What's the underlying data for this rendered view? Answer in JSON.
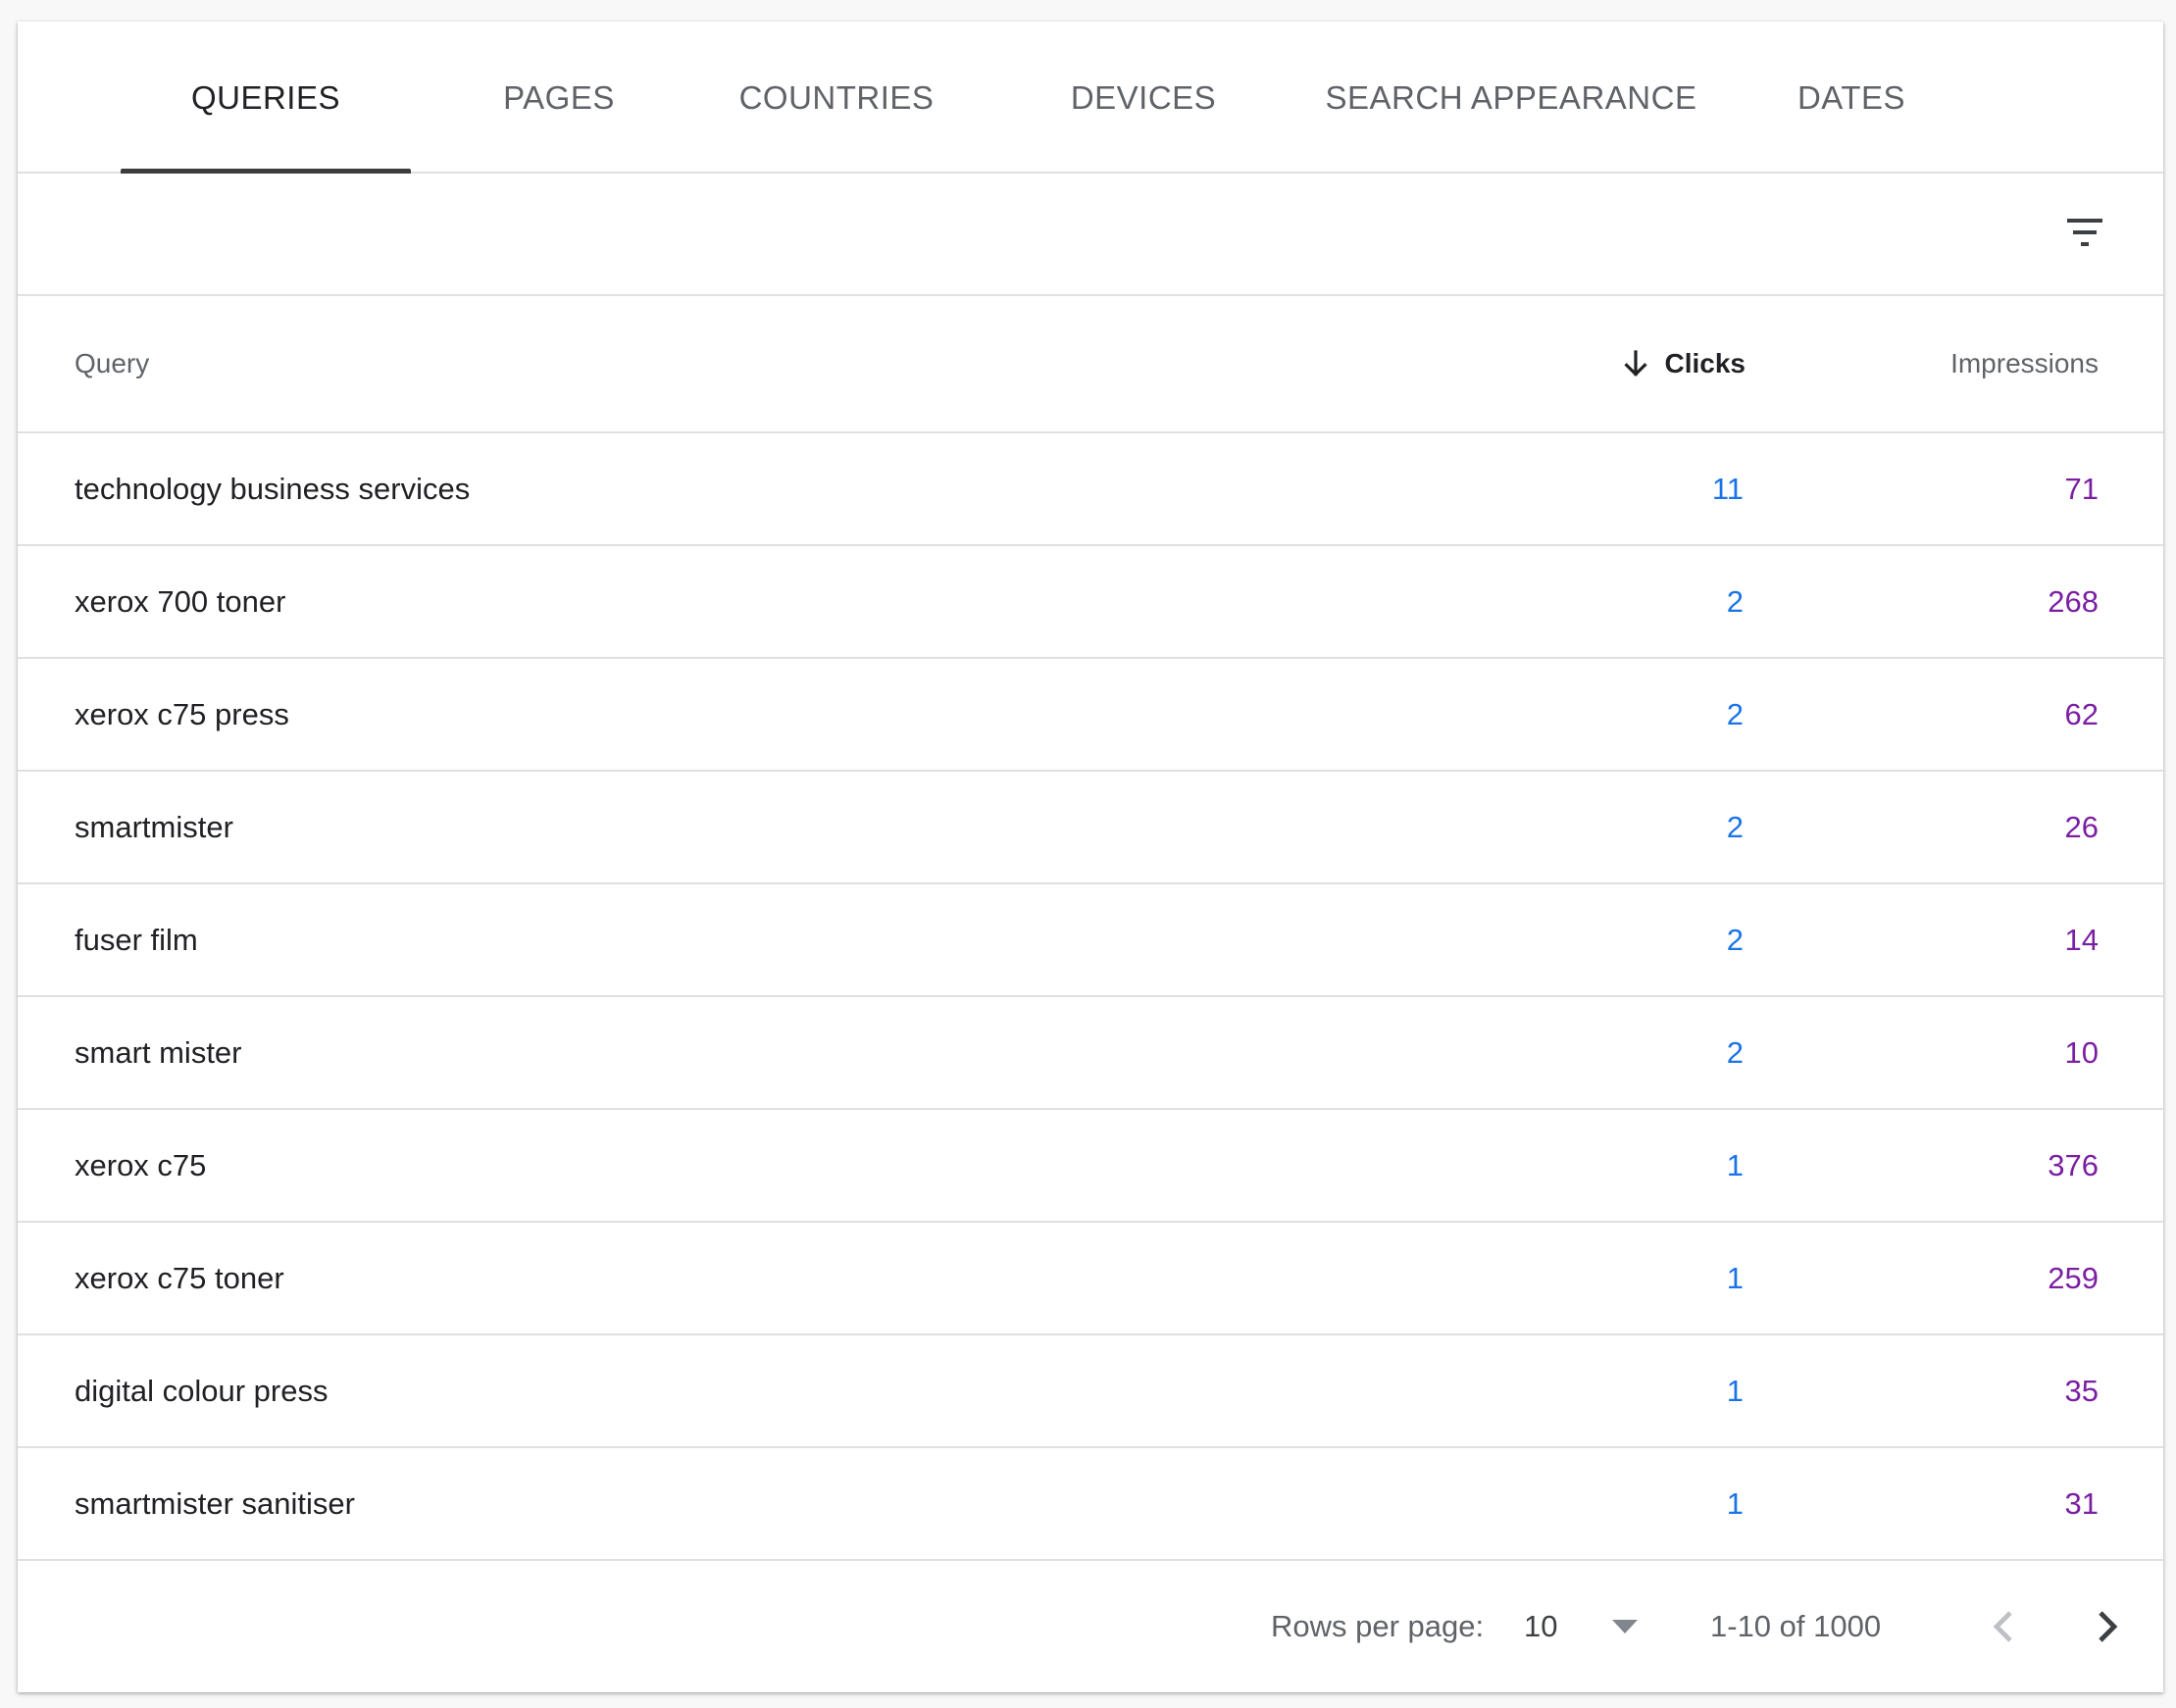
{
  "tabs": [
    {
      "label": "QUERIES",
      "active": true
    },
    {
      "label": "PAGES",
      "active": false
    },
    {
      "label": "COUNTRIES",
      "active": false
    },
    {
      "label": "DEVICES",
      "active": false
    },
    {
      "label": "SEARCH APPEARANCE",
      "active": false
    },
    {
      "label": "DATES",
      "active": false
    }
  ],
  "filter": {
    "icon": "filter-icon"
  },
  "table": {
    "headers": {
      "query": "Query",
      "clicks": "Clicks",
      "impressions": "Impressions",
      "sort_icon": "arrow-down-icon"
    },
    "rows": [
      {
        "query": "technology business services",
        "clicks": "11",
        "impressions": "71"
      },
      {
        "query": "xerox 700 toner",
        "clicks": "2",
        "impressions": "268"
      },
      {
        "query": "xerox c75 press",
        "clicks": "2",
        "impressions": "62"
      },
      {
        "query": "smartmister",
        "clicks": "2",
        "impressions": "26"
      },
      {
        "query": "fuser film",
        "clicks": "2",
        "impressions": "14"
      },
      {
        "query": "smart mister",
        "clicks": "2",
        "impressions": "10"
      },
      {
        "query": "xerox c75",
        "clicks": "1",
        "impressions": "376"
      },
      {
        "query": "xerox c75 toner",
        "clicks": "1",
        "impressions": "259"
      },
      {
        "query": "digital colour press",
        "clicks": "1",
        "impressions": "35"
      },
      {
        "query": "smartmister sanitiser",
        "clicks": "1",
        "impressions": "31"
      }
    ]
  },
  "pagination": {
    "rows_per_page_label": "Rows per page:",
    "rows_per_page_value": "10",
    "range_text": "1-10 of 1000"
  },
  "colors": {
    "clicks": "#1a73e8",
    "impressions": "#7b1fa2",
    "tab_indicator": "#3c3c3c"
  }
}
